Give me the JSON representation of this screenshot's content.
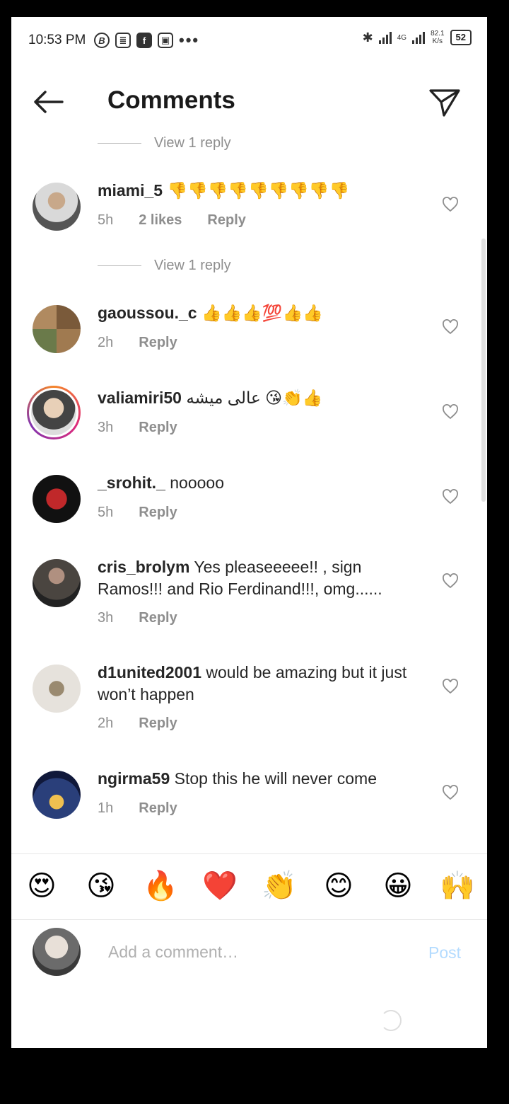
{
  "status_bar": {
    "time": "10:53 PM",
    "app_icons": [
      "B",
      "≣",
      "f",
      "▣"
    ],
    "more": "•••",
    "network_type": "4G",
    "speed_value": "82.1",
    "speed_unit": "K/s",
    "battery": "52"
  },
  "header": {
    "title": "Comments"
  },
  "view_replies": [
    {
      "label": "View 1 reply"
    },
    {
      "label": "View 1 reply"
    }
  ],
  "comments": [
    {
      "username": "miami_5",
      "text": "👎👎👎👎👎👎👎👎👎",
      "time": "5h",
      "likes": "2 likes",
      "reply": "Reply",
      "avatar_color": "#c9d2c0"
    },
    {
      "username": "gaoussou._c",
      "text": "👍👍👍💯👍👍",
      "time": "2h",
      "reply": "Reply",
      "avatar_color": "#8a6a4a"
    },
    {
      "username": "valiamiri50",
      "text": "عالی میشه 😘👏👍",
      "time": "3h",
      "reply": "Reply",
      "avatar_color": "#d9c9b8"
    },
    {
      "username": "_srohit._",
      "text": "nooooo",
      "time": "5h",
      "reply": "Reply",
      "avatar_color": "#1a1a1a"
    },
    {
      "username": "cris_brolym",
      "text": "Yes pleaseeeee!! , sign Ramos!!! and Rio Ferdinand!!!, omg......",
      "time": "3h",
      "reply": "Reply",
      "avatar_color": "#3b3530"
    },
    {
      "username": "d1united2001",
      "text": "would be amazing but it just won’t happen",
      "time": "2h",
      "reply": "Reply",
      "avatar_color": "#e0ddd8"
    },
    {
      "username": "ngirma59",
      "text": "Stop this he will never come",
      "time": "1h",
      "reply": "Reply",
      "avatar_color": "#1f2f5a"
    }
  ],
  "emoji_bar": [
    "😍",
    "😘",
    "🔥",
    "❤️",
    "👏",
    "😊",
    "😀",
    "🙌"
  ],
  "composer": {
    "placeholder": "Add a comment…",
    "post_label": "Post"
  }
}
